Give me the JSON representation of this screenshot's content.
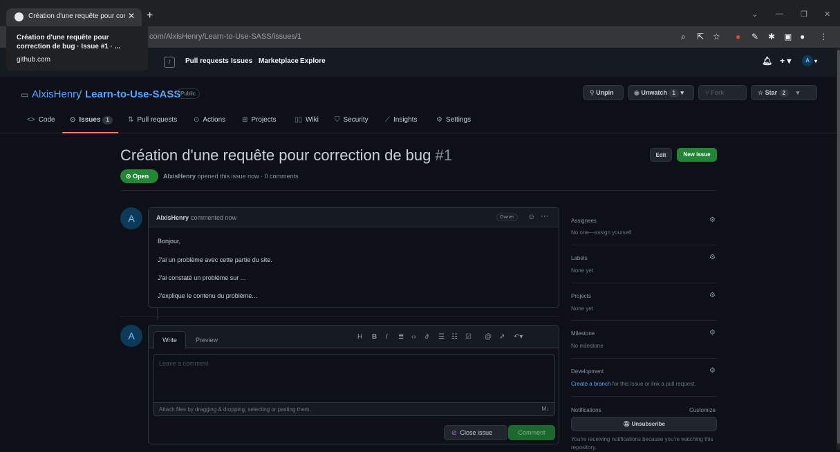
{
  "browser": {
    "tab_title": "Création d'une requête pour corr",
    "url": "com/AlxisHenry/Learn-to-Use-SASS/issues/1",
    "tooltip_title": "Création d'une requête pour correction de bug · Issue #1 · ...",
    "tooltip_host": "github.com"
  },
  "github_nav": {
    "slash_key": "/",
    "items": [
      "Pull requests",
      "Issues",
      "Marketplace",
      "Explore"
    ]
  },
  "repo": {
    "owner": "AlxisHenry",
    "separator": "/",
    "name": "Learn-to-Use-SASS",
    "visibility": "Public",
    "unpin_label": "Unpin",
    "unwatch_label": "Unwatch",
    "unwatch_count": "1",
    "fork_label": "Fork",
    "star_label": "Star",
    "star_count": "2",
    "tabs": [
      {
        "label": "Code"
      },
      {
        "label": "Issues",
        "count": "1"
      },
      {
        "label": "Pull requests"
      },
      {
        "label": "Actions"
      },
      {
        "label": "Projects"
      },
      {
        "label": "Wiki"
      },
      {
        "label": "Security"
      },
      {
        "label": "Insights"
      },
      {
        "label": "Settings"
      }
    ]
  },
  "issue": {
    "title": "Création d'une requête pour correction de bug",
    "number": "#1",
    "edit_label": "Edit",
    "new_issue_label": "New issue",
    "state": "Open",
    "author": "AlxisHenry",
    "opened_text": "opened this issue now · 0 comments"
  },
  "comment": {
    "author": "AlxisHenry",
    "when": "commented now",
    "role": "Owner",
    "lines": [
      "Bonjour,",
      "J'ai un problème avec cette partie du site.",
      "J'ai constaté un problème sur ...",
      "J'explique le contenu du problème..."
    ]
  },
  "composer": {
    "tab_write": "Write",
    "tab_preview": "Preview",
    "placeholder": "Leave a comment",
    "attach_text": "Attach files by dragging & dropping, selecting or pasting them.",
    "close_issue_label": "Close issue",
    "comment_label": "Comment"
  },
  "sidebar": {
    "assignees_label": "Assignees",
    "assignees_value": "No one—assign yourself",
    "labels_label": "Labels",
    "labels_value": "None yet",
    "projects_label": "Projects",
    "projects_value": "None yet",
    "milestone_label": "Milestone",
    "milestone_value": "No milestone",
    "development_label": "Development",
    "development_link": "Create a branch",
    "development_rest": " for this issue or link a pull request.",
    "notifications_label": "Notifications",
    "customize_label": "Customize",
    "unsubscribe_label": "Unsubscribe",
    "notification_note": "You're receiving notifications because you're watching this repository."
  },
  "colors": {
    "accent_link": "#58a6ff",
    "open_green": "#238636",
    "tab_underline": "#f78166"
  }
}
